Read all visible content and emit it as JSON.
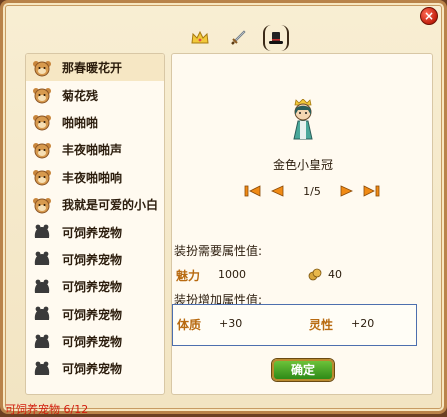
{
  "window": {
    "close_label": "×"
  },
  "tabs": [
    {
      "icon": "crown-icon"
    },
    {
      "icon": "sword-icon"
    },
    {
      "icon": "hat-icon",
      "active": true
    }
  ],
  "pet_list": [
    {
      "label": "那春暖花开",
      "icon": "pet-face-icon",
      "selected": true
    },
    {
      "label": "菊花残",
      "icon": "pet-face-icon"
    },
    {
      "label": "啪啪啪",
      "icon": "pet-face-icon"
    },
    {
      "label": "丰夜啪啪声",
      "icon": "pet-face-icon"
    },
    {
      "label": "丰夜啪啪响",
      "icon": "pet-face-icon"
    },
    {
      "label": "我就是可爱的小白",
      "icon": "pet-face-icon"
    },
    {
      "label": "可饲养宠物",
      "icon": "pet-silhouette-icon"
    },
    {
      "label": "可饲养宠物",
      "icon": "pet-silhouette-icon"
    },
    {
      "label": "可饲养宠物",
      "icon": "pet-silhouette-icon"
    },
    {
      "label": "可饲养宠物",
      "icon": "pet-silhouette-icon"
    },
    {
      "label": "可饲养宠物",
      "icon": "pet-silhouette-icon"
    },
    {
      "label": "可饲养宠物",
      "icon": "pet-silhouette-icon"
    }
  ],
  "item": {
    "name": "金色小皇冠",
    "page": "1/5"
  },
  "requirements": {
    "title": "装扮需要属性值:",
    "charm_label": "魅力",
    "charm_value": "1000",
    "coin_value": "40"
  },
  "bonus": {
    "title": "装扮增加属性值:",
    "stamina_label": "体质",
    "stamina_value": "+30",
    "spirit_label": "灵性",
    "spirit_value": "+20"
  },
  "confirm_label": "确定",
  "footer_text": "可饲养宠物 6/12",
  "colors": {
    "frame": "#b9834a",
    "panel": "#fffaf0",
    "attr_label": "#b86a10",
    "footer": "#d21c0c",
    "confirm": "#2e8a17"
  }
}
